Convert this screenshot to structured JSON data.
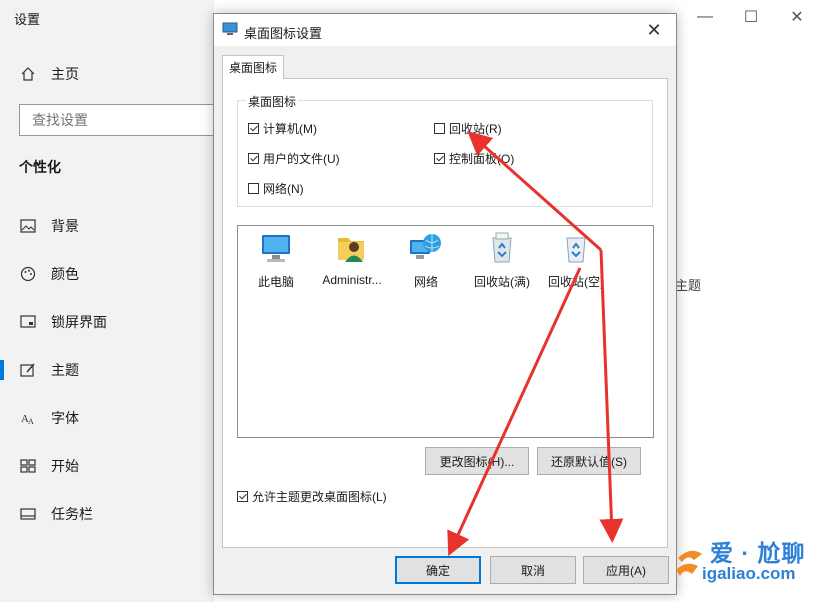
{
  "settings": {
    "title": "设置",
    "nav_home": "主页",
    "search_placeholder": "查找设置",
    "section": "个性化",
    "nav": [
      {
        "label": "背景"
      },
      {
        "label": "颜色"
      },
      {
        "label": "锁屏界面"
      },
      {
        "label": "主题"
      },
      {
        "label": "字体"
      },
      {
        "label": "开始"
      },
      {
        "label": "任务栏"
      }
    ],
    "active_item": "主题",
    "right_text": "主题",
    "window_controls": {
      "minimize": "—",
      "maximize": "☐",
      "close": "✕"
    }
  },
  "dialog": {
    "title": "桌面图标设置",
    "tab": "桌面图标",
    "group_label": "桌面图标",
    "checkboxes": [
      {
        "label": "计算机(M)",
        "checked": true
      },
      {
        "label": "回收站(R)",
        "checked": false
      },
      {
        "label": "用户的文件(U)",
        "checked": true
      },
      {
        "label": "控制面板(O)",
        "checked": true
      },
      {
        "label": "网络(N)",
        "checked": false
      }
    ],
    "icons": [
      {
        "label": "此电脑",
        "icon": "computer-icon"
      },
      {
        "label": "Administr...",
        "icon": "user-folder-icon"
      },
      {
        "label": "网络",
        "icon": "network-icon"
      },
      {
        "label": "回收站(满)",
        "icon": "recycle-bin-full-icon"
      },
      {
        "label": "回收站(空)",
        "icon": "recycle-bin-empty-icon"
      }
    ],
    "change_icon_button": "更改图标(H)...",
    "restore_default_button": "还原默认值(S)",
    "allow_theme_checkbox": {
      "label": "允许主题更改桌面图标(L)",
      "checked": true
    },
    "ok_button": "确定",
    "cancel_button": "取消",
    "apply_button": "应用(A)",
    "close_glyph": "✕"
  },
  "watermark": {
    "line1": "爱 · 尬聊",
    "line2": "igaliao.com"
  },
  "colors": {
    "accent": "#0078d7",
    "arrow": "#e8322c"
  }
}
